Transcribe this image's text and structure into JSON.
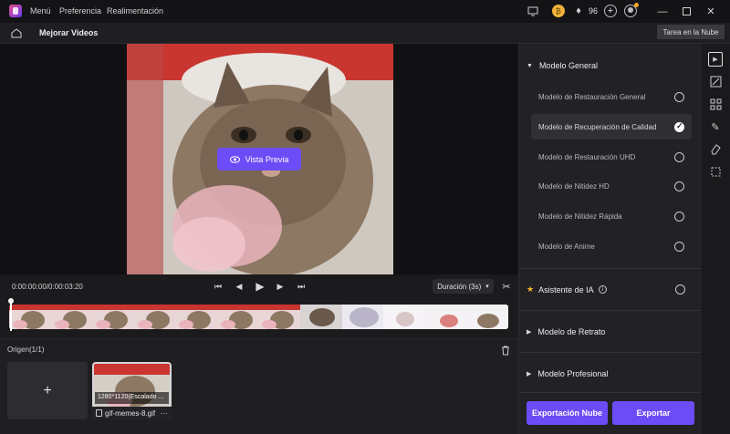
{
  "titlebar": {
    "menu": [
      "Menú",
      "Preferencia",
      "Realimentación"
    ],
    "credits": "96",
    "icons": [
      "monitor-icon",
      "coin-icon",
      "gem-icon",
      "plus-icon",
      "avatar-icon"
    ],
    "window_controls": [
      "minimize",
      "maximize",
      "close"
    ]
  },
  "header": {
    "title": "Mejorar Videos",
    "cloud_task": "Tarea en la Nube"
  },
  "preview": {
    "button": "Vista Previa"
  },
  "playback": {
    "time": "0:00:00:00/0:00:03:20",
    "duration": "Duración (3s)",
    "controls": [
      "skip-back",
      "step-back",
      "play",
      "step-forward",
      "skip-forward"
    ]
  },
  "source": {
    "title": "Origen(1/1)",
    "add_label": "+",
    "media": {
      "resolution": "1280*1120(Escalado ...",
      "filename": "gif-memes-8.gif",
      "more": "···"
    }
  },
  "panel": {
    "general": {
      "title": "Modelo General",
      "models": [
        {
          "label": "Modelo de Restauración General",
          "selected": false
        },
        {
          "label": "Modelo de Recuperación de Calidad",
          "selected": true
        },
        {
          "label": "Modelo de Restauración UHD",
          "selected": false
        },
        {
          "label": "Modelo de Nitidez HD",
          "selected": false
        },
        {
          "label": "Modelo de Nitidez Rápida",
          "selected": false
        },
        {
          "label": "Modelo de Anime",
          "selected": false
        }
      ]
    },
    "ai_assistant": "Asistente de IA",
    "portrait": "Modelo de Retrato",
    "professional": "Modelo Profesional",
    "export_cloud": "Exportación Nube",
    "export": "Exportar"
  },
  "colors": {
    "accent": "#6c4cf6",
    "star": "#f5b72e"
  }
}
